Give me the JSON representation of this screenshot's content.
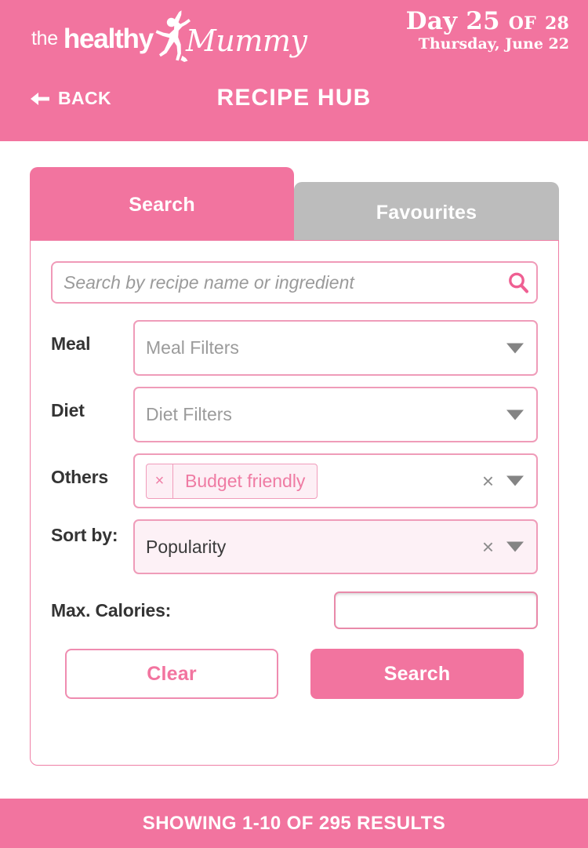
{
  "brand": {
    "logo_the": "the",
    "logo_healthy": "healthy",
    "logo_mummy": "Mummy",
    "figure_icon": "jumping-woman-silhouette-icon"
  },
  "header": {
    "day_prefix": "Day",
    "day_number": "25",
    "day_of": "OF",
    "day_total": "28",
    "date": "Thursday, June 22",
    "back_label": "BACK",
    "back_icon": "arrow-left-icon",
    "title": "RECIPE HUB",
    "background_color": "#F2749F"
  },
  "tabs": [
    {
      "label": "Search",
      "active": true
    },
    {
      "label": "Favourites",
      "active": false
    }
  ],
  "search": {
    "placeholder": "Search by recipe name or ingredient",
    "value": "",
    "icon": "search-icon"
  },
  "filters": [
    {
      "label": "Meal",
      "placeholder": "Meal Filters",
      "value": "",
      "caret_icon": "chevron-down-icon"
    },
    {
      "label": "Diet",
      "placeholder": "Diet Filters",
      "value": "",
      "caret_icon": "chevron-down-icon"
    },
    {
      "label": "Others",
      "chip": "Budget friendly",
      "chip_remove_icon": "close-icon",
      "clear_icon": "clear-icon",
      "caret_icon": "chevron-down-icon"
    },
    {
      "label": "Sort by:",
      "value": "Popularity",
      "clear_icon": "clear-icon",
      "caret_icon": "chevron-down-icon"
    }
  ],
  "calories": {
    "label": "Max. Calories:",
    "value": "",
    "placeholder": ""
  },
  "buttons": {
    "clear": "Clear",
    "search": "Search"
  },
  "footer": {
    "results_text": "SHOWING 1-10 OF 295 RESULTS",
    "background_color": "#F2749F"
  },
  "colors": {
    "brand_pink": "#F2749F",
    "light_pink_fill": "#FDF1F6",
    "border_pink": "#EF9CB9",
    "inactive_tab_gray": "#BCBCBC"
  }
}
